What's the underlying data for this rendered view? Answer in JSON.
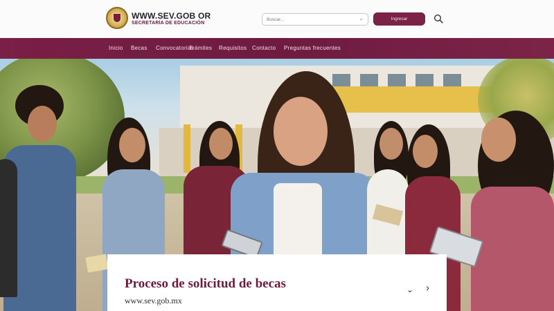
{
  "header": {
    "site_title": "WWW.SEV.GOB OR",
    "site_subtitle": "SECRETARÍA DE EDUCACIÓN",
    "search_placeholder": "Buscar...",
    "primary_button_label": "Ingresar"
  },
  "nav": {
    "items": [
      "Inicio",
      "Becas",
      "Convocatorias",
      "Trámites",
      "Requisitos",
      "Contacto",
      "Preguntas frecuentes"
    ]
  },
  "hero": {
    "card_title": "Proceso de solicitud de becas",
    "card_url": "www.sev.gob.mx",
    "prev_control": "⌄",
    "next_control": "›"
  },
  "colors": {
    "brand": "#7a1f45",
    "brand_dark": "#6b1c3d",
    "nav_text": "#f2e3ea"
  }
}
